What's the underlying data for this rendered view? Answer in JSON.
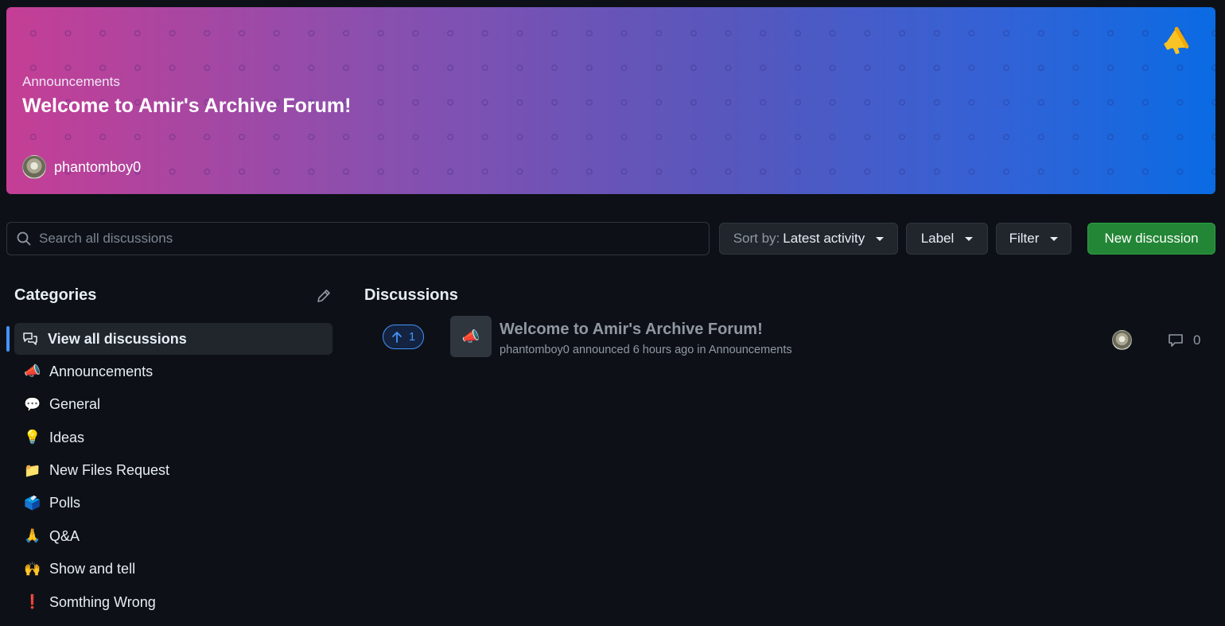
{
  "banner": {
    "category": "Announcements",
    "title": "Welcome to Amir's Archive Forum!",
    "author": "phantomboy0",
    "icon": "megaphone-icon",
    "gradient_colors": [
      "#c53e95",
      "#8b4fae",
      "#5757bd",
      "#3362d6",
      "#0a6be3"
    ]
  },
  "search": {
    "placeholder": "Search all discussions",
    "value": ""
  },
  "toolbar": {
    "sort_prefix": "Sort by:",
    "sort_value": "Latest activity",
    "label_button": "Label",
    "filter_button": "Filter",
    "new_discussion_button": "New discussion",
    "new_discussion_color": "#238636"
  },
  "categories": {
    "heading": "Categories",
    "edit_icon": "pencil-icon",
    "items": [
      {
        "label": "View all discussions",
        "icon": "comment-discussion-icon",
        "active": true
      },
      {
        "label": "Announcements",
        "emoji": "📣"
      },
      {
        "label": "General",
        "emoji": "💬"
      },
      {
        "label": "Ideas",
        "emoji": "💡"
      },
      {
        "label": "New Files Request",
        "emoji": "📁"
      },
      {
        "label": "Polls",
        "emoji": "🗳️"
      },
      {
        "label": "Q&A",
        "emoji": "🙏"
      },
      {
        "label": "Show and tell",
        "emoji": "🙌"
      },
      {
        "label": "Somthing Wrong",
        "emoji": "❗"
      }
    ]
  },
  "discussions": {
    "heading": "Discussions",
    "items": [
      {
        "upvotes": "1",
        "category_emoji": "📣",
        "title": "Welcome to Amir's Archive Forum!",
        "meta": "phantomboy0 announced 6 hours ago in Announcements",
        "comments": "0"
      }
    ]
  },
  "accent_color": "#4493f8"
}
